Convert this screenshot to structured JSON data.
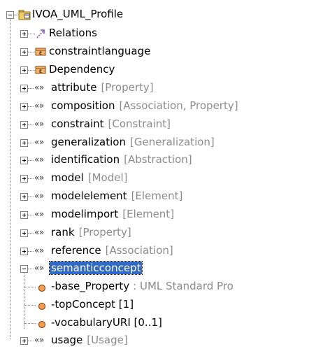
{
  "root": {
    "label": "IVOA_UML_Profile"
  },
  "items": [
    {
      "kind": "relations",
      "name": "Relations",
      "type": ""
    },
    {
      "kind": "enum",
      "name": "constraintlanguage",
      "type": ""
    },
    {
      "kind": "enum",
      "name": "Dependency",
      "type": ""
    },
    {
      "kind": "stereo",
      "name": "attribute",
      "type": "[Property]"
    },
    {
      "kind": "stereo",
      "name": "composition",
      "type": "[Association, Property]"
    },
    {
      "kind": "stereo",
      "name": "constraint",
      "type": "[Constraint]"
    },
    {
      "kind": "stereo",
      "name": "generalization",
      "type": "[Generalization]"
    },
    {
      "kind": "stereo",
      "name": "identification",
      "type": "[Abstraction]"
    },
    {
      "kind": "stereo",
      "name": "model",
      "type": "[Model]"
    },
    {
      "kind": "stereo",
      "name": "modelelement",
      "type": "[Element]"
    },
    {
      "kind": "stereo",
      "name": "modelimport",
      "type": "[Element]"
    },
    {
      "kind": "stereo",
      "name": "rank",
      "type": "[Property]"
    },
    {
      "kind": "stereo",
      "name": "reference",
      "type": "[Association]"
    },
    {
      "kind": "stereo",
      "name": "semanticconcept",
      "type": "",
      "selected": true
    },
    {
      "kind": "stereo",
      "name": "usage",
      "type": "[Usage]"
    }
  ],
  "semanticconcept_children": [
    {
      "name": "-base_Property",
      "type": ": UML Standard Pro"
    },
    {
      "name": "-topConcept [1]",
      "type": ""
    },
    {
      "name": "-vocabularyURI [0..1]",
      "type": ""
    }
  ],
  "stereotype_glyph": "«»",
  "colors": {
    "selection": "#316ac5",
    "type_text": "#8c8c8c",
    "property_icon": "#e07b2a",
    "package_icon": "#e8b44a"
  }
}
